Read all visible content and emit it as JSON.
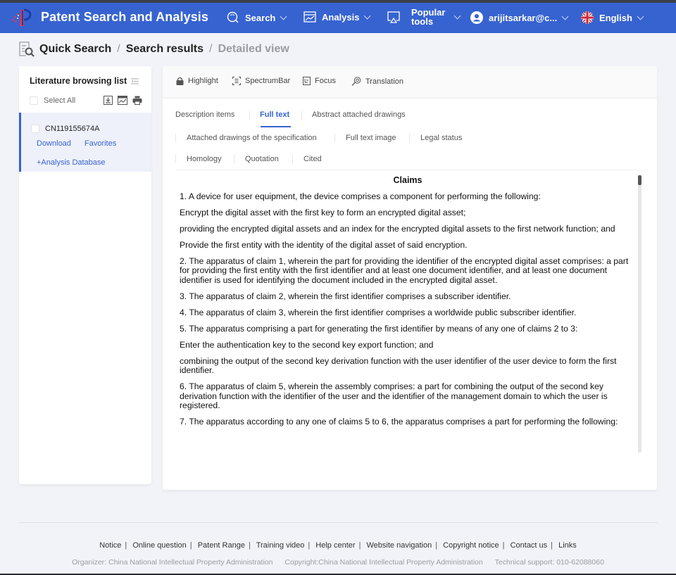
{
  "app": {
    "title": "Patent Search and Analysis"
  },
  "nav": {
    "search": "Search",
    "analysis": "Analysis",
    "popular_line1": "Popular",
    "popular_line2": "tools",
    "user": "arijitsarkar@c...",
    "language": "English"
  },
  "breadcrumb": {
    "items": [
      "Quick Search",
      "Search results",
      "Detailed view"
    ],
    "separator": "/"
  },
  "sidebar": {
    "title": "Literature browsing list",
    "select_all": "Select All",
    "documents": [
      {
        "number": "CN119155674A",
        "download": "Download",
        "favorites": "Favorites",
        "analysis_db": "+Analysis Database",
        "selected": true
      }
    ]
  },
  "toolbar": {
    "highlight": "Highlight",
    "spectrumbar": "SpectrumBar",
    "focus": "Focus",
    "translation": "Translation"
  },
  "tabs": {
    "row1": [
      "Description items",
      "Full text",
      "Abstract attached drawings"
    ],
    "row2": [
      "Attached drawings of the specification",
      "Full text image",
      "Legal status"
    ],
    "row3": [
      "Homology",
      "Quotation",
      "Cited"
    ],
    "active": "Full text"
  },
  "claims": {
    "heading": "Claims",
    "paragraphs": [
      "1. A device for user equipment, the device comprises a component for performing the following:",
      "Encrypt the digital asset with the first key to form an encrypted digital asset;",
      "providing the encrypted digital assets and an index for the encrypted digital assets to the first network function; and",
      "Provide the first entity with the identity of the digital asset of said encryption.",
      "2. The apparatus of claim 1, wherein the part for providing the identifier of the encrypted digital asset comprises: a part for providing the first entity with the first identifier and at least one document identifier, and at least one document identifier is used for identifying the document included in the encrypted digital asset.",
      "3. The apparatus of claim 2, wherein the first identifier comprises a subscriber identifier.",
      "4. The apparatus of claim 3, wherein the first identifier comprises a worldwide public subscriber identifier.",
      "5. The apparatus comprising a part for generating the first identifier by means of any one of claims 2 to 3:",
      "Enter the authentication key to the second key export function; and",
      "combining the output of the second key derivation function with the user identifier of the user device to form the first identifier.",
      "6. The apparatus of claim 5, wherein the assembly comprises: a part for combining the output of the second key derivation function with the identifier of the user and the identifier of the management domain to which the user is registered.",
      "7. The apparatus according to any one of claims 5 to 6, the apparatus comprises a part for performing the following:"
    ]
  },
  "footer": {
    "links": [
      "Notice",
      "Online question",
      "Patent Range",
      "Training video",
      "Help center",
      "Website navigation",
      "Copyright notice",
      "Contact us",
      "Links"
    ],
    "organizer": "Organizer: China National Intellectual Property Administration",
    "copyright": "Copyright:China National Intellectual Property Administration",
    "support": "Technical support: 010-62088060"
  },
  "colors": {
    "brand": "#3763d1",
    "background": "#f2f3f8",
    "active_tab": "#3763d1"
  }
}
